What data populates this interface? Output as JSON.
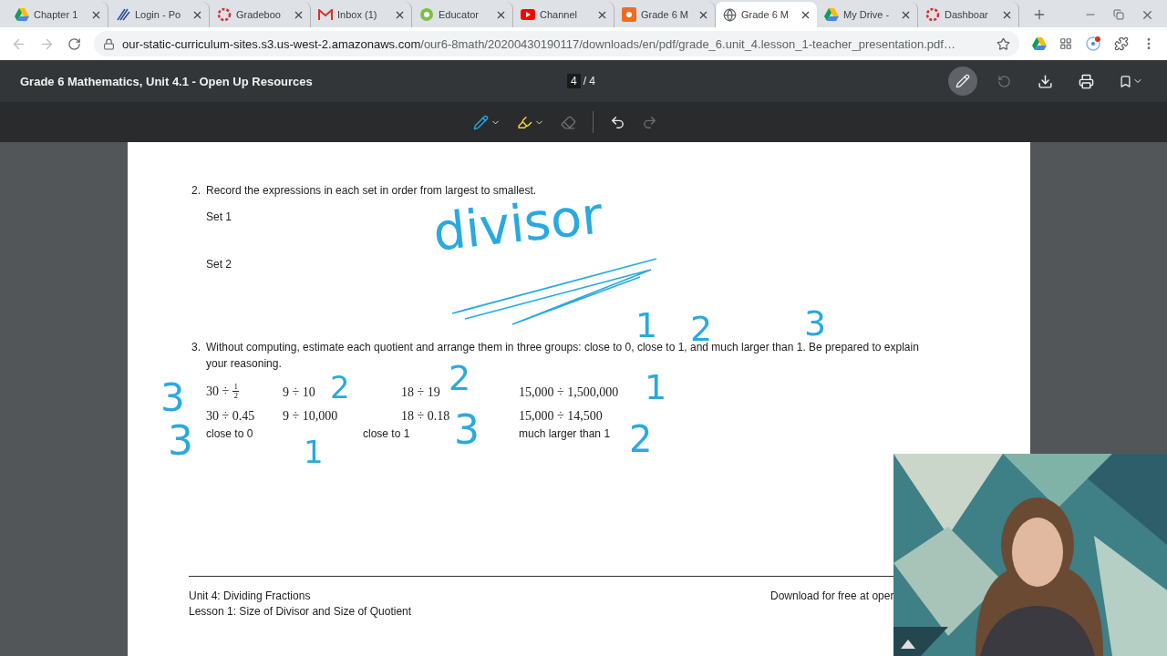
{
  "browser": {
    "tabs": [
      {
        "title": "Chapter 1",
        "selected": false
      },
      {
        "title": "Login - Po",
        "selected": false
      },
      {
        "title": "Gradeboo",
        "selected": false
      },
      {
        "title": "Inbox (1)",
        "selected": false
      },
      {
        "title": "Educator",
        "selected": false
      },
      {
        "title": "Channel",
        "selected": false
      },
      {
        "title": "Grade 6 M",
        "selected": false
      },
      {
        "title": "Grade 6 M",
        "selected": true
      },
      {
        "title": "My Drive -",
        "selected": false
      },
      {
        "title": "Dashboar",
        "selected": false
      }
    ],
    "address": {
      "host": "our-static-curriculum-sites.s3.us-west-2.amazonaws.com",
      "path": "/our6-8math/20200430190117/downloads/en/pdf/grade_6.unit_4.lesson_1-teacher_presentation.pdf…"
    }
  },
  "pdf_viewer": {
    "title": "Grade 6 Mathematics, Unit 4.1 - Open Up Resources",
    "page_current": "4",
    "page_total": "/ 4",
    "annotate_on": true,
    "tools": [
      {
        "kind": "pen",
        "disabled": false
      },
      {
        "kind": "highlighter",
        "disabled": false
      },
      {
        "kind": "eraser",
        "disabled": true
      },
      {
        "kind": "undo",
        "disabled": false
      },
      {
        "kind": "redo",
        "disabled": true
      }
    ],
    "rotate_disabled": true
  },
  "document": {
    "question_2": {
      "number": "2.",
      "text": "Record the expressions in each set in order from largest to smallest.",
      "sets": [
        "Set 1",
        "Set 2"
      ]
    },
    "question_3": {
      "number": "3.",
      "text": "Without computing, estimate each quotient and arrange them in three groups: close to 0, close to 1, and much larger than 1. Be prepared to explain your reasoning.",
      "expressions": [
        {
          "text": "30 ÷",
          "num": "1",
          "den": "2"
        },
        {
          "text": "9 ÷ 10"
        },
        {
          "text": "18 ÷ 19"
        },
        {
          "text": "15,000 ÷ 1,500,000"
        },
        {
          "text": "30 ÷ 0.45"
        },
        {
          "text": "9 ÷ 10,000"
        },
        {
          "text": "18 ÷ 0.18"
        },
        {
          "text": "15,000 ÷ 14,500"
        }
      ],
      "groups": [
        "close to 0",
        "close to 1",
        "much larger than 1"
      ]
    },
    "footer": {
      "unit": "Unit 4: Dividing Fractions",
      "lesson": "Lesson 1: Size of Divisor and Size of Quotient",
      "download": "Download for free at oper"
    }
  },
  "annotations": [
    {
      "text": "divisor"
    },
    {
      "text": "1"
    },
    {
      "text": "2"
    },
    {
      "text": "3"
    },
    {
      "text": "3"
    },
    {
      "text": "2"
    },
    {
      "text": "2"
    },
    {
      "text": "1"
    },
    {
      "text": "3"
    },
    {
      "text": "1"
    },
    {
      "text": "3"
    },
    {
      "text": "2"
    }
  ]
}
